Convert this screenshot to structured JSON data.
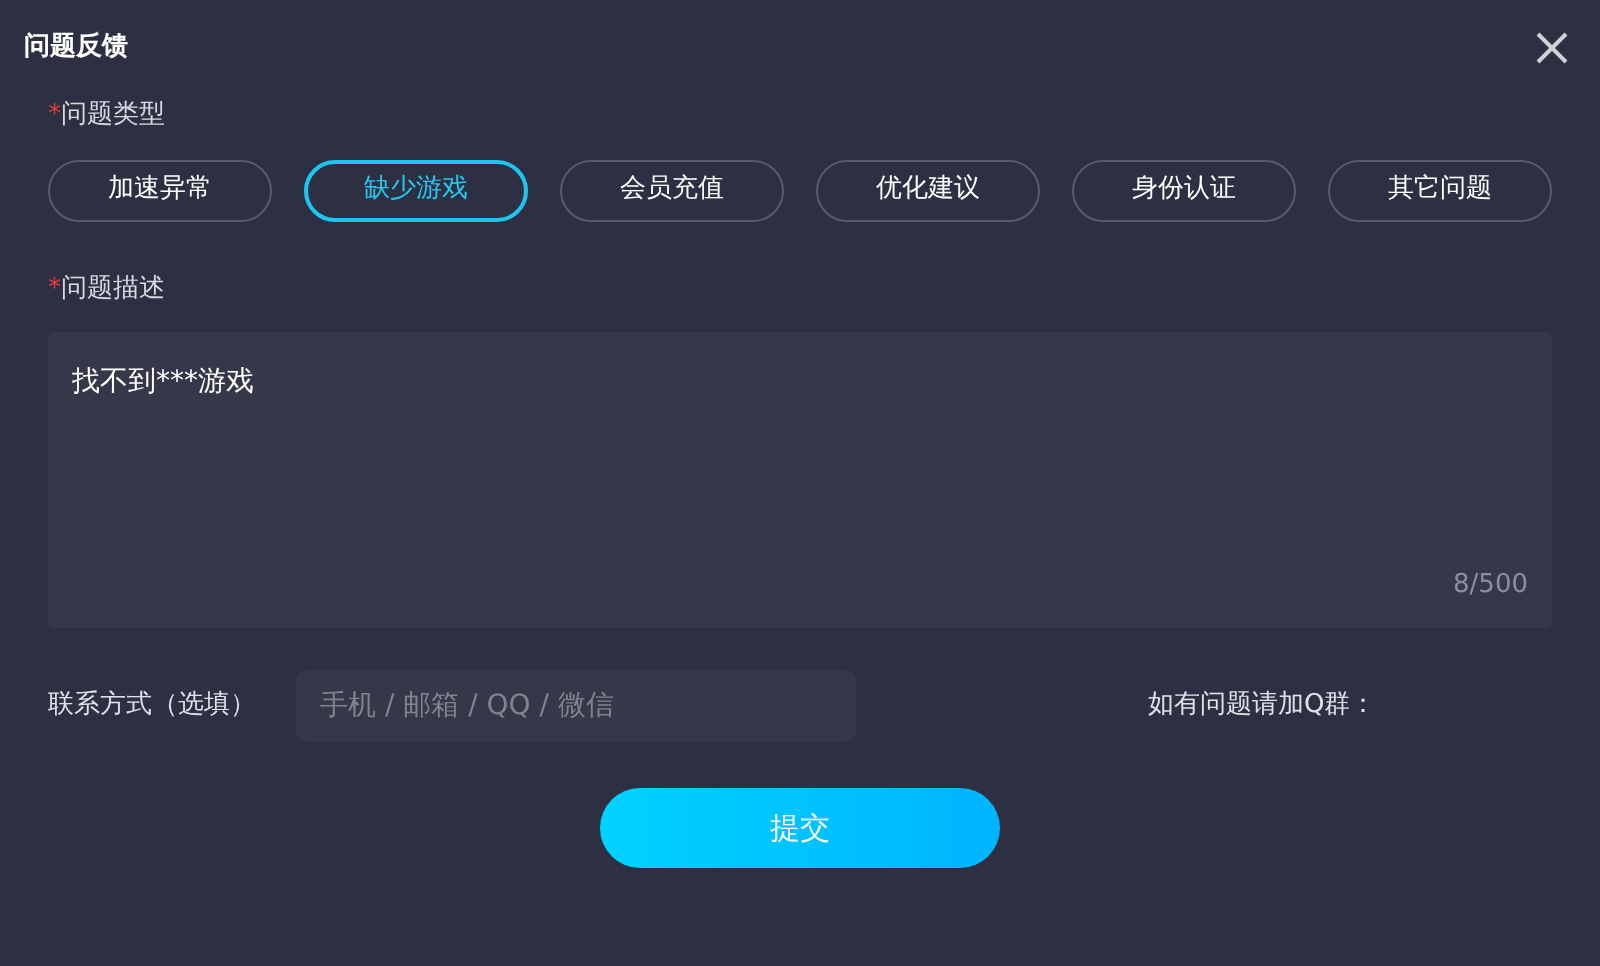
{
  "window": {
    "title": "问题反馈"
  },
  "type_section": {
    "required_mark": "*",
    "label": "问题类型",
    "options": [
      {
        "label": "加速异常",
        "selected": false
      },
      {
        "label": "缺少游戏",
        "selected": true
      },
      {
        "label": "会员充值",
        "selected": false
      },
      {
        "label": "优化建议",
        "selected": false
      },
      {
        "label": "身份认证",
        "selected": false
      },
      {
        "label": "其它问题",
        "selected": false
      }
    ]
  },
  "description": {
    "required_mark": "*",
    "label": "问题描述",
    "value": "找不到***游戏",
    "counter": "8/500"
  },
  "contact": {
    "label": "联系方式（选填）",
    "placeholder": "手机 / 邮箱 / QQ / 微信"
  },
  "group_hint": "如有问题请加Q群：",
  "submit": "提交"
}
